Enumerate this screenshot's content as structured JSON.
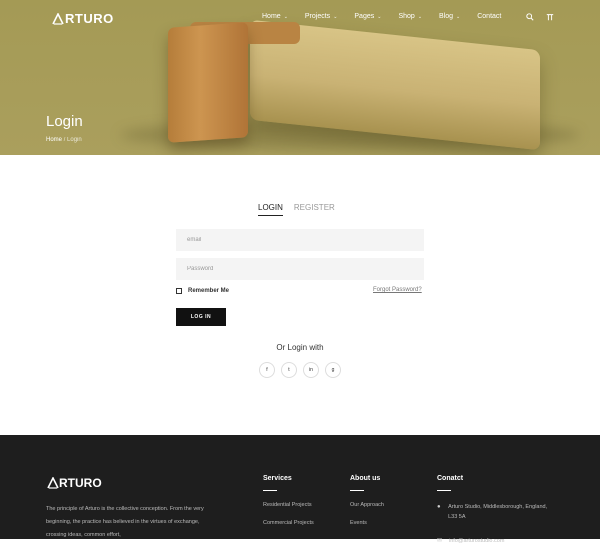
{
  "header": {
    "logo_text": "RTURO",
    "nav": [
      {
        "label": "Home"
      },
      {
        "label": "Projects"
      },
      {
        "label": "Pages"
      },
      {
        "label": "Shop"
      },
      {
        "label": "Blog"
      },
      {
        "label": "Contact"
      }
    ]
  },
  "hero": {
    "title": "Login",
    "breadcrumb_home": "Home",
    "breadcrumb_sep": "/",
    "breadcrumb_current": "Login"
  },
  "form": {
    "tab_login": "LOGIN",
    "tab_register": "REGISTER",
    "email_placeholder": "email",
    "password_placeholder": "Password",
    "remember_label": "Remember Me",
    "forgot_label": "Forgot Password?",
    "login_button": "LOG IN",
    "or_login_with": "Or Login with",
    "socials": [
      "f",
      "t",
      "in",
      "g"
    ]
  },
  "footer": {
    "logo_text": "RTURO",
    "about": "The principle of Arturo is the collective conception. From the very beginning, the practice has believed in the virtues of exchange, crossing ideas, common effort,",
    "services_title": "Services",
    "services": [
      "Residential Projects",
      "Commercial Projects"
    ],
    "about_title": "About us",
    "about_links": [
      "Our Approach",
      "Events"
    ],
    "contact_title": "Conatct",
    "contact_address": "Arturo Studio, Middlesborough, England, L33 5A",
    "contact_email": "info@arturostudio.com"
  }
}
